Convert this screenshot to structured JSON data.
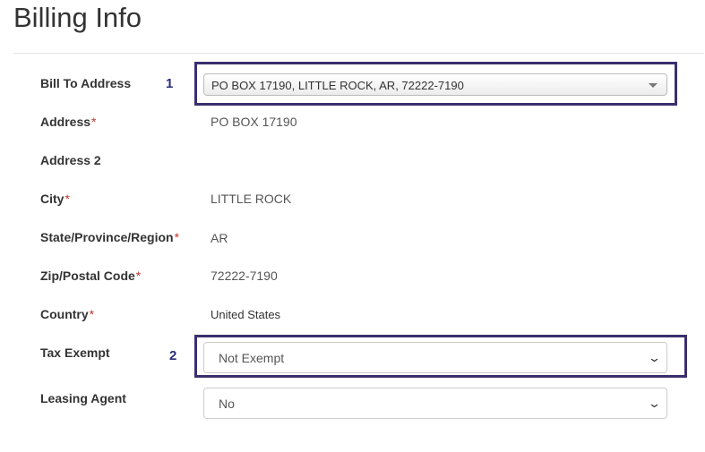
{
  "page_title": "Billing Info",
  "required_marker": "*",
  "fields": {
    "bill_to": {
      "label": "Bill To Address",
      "badge": "1",
      "selected": "PO BOX 17190, LITTLE ROCK, AR, 72222-7190"
    },
    "address": {
      "label": "Address",
      "value": "PO BOX 17190"
    },
    "address2": {
      "label": "Address 2",
      "value": ""
    },
    "city": {
      "label": "City",
      "value": "LITTLE ROCK"
    },
    "state": {
      "label": "State/Province/Region",
      "value": "AR"
    },
    "zip": {
      "label": "Zip/Postal Code",
      "value": "72222-7190"
    },
    "country": {
      "label": "Country",
      "value": "United States"
    },
    "tax_exempt": {
      "label": "Tax Exempt",
      "badge": "2",
      "selected": "Not Exempt"
    },
    "leasing_agent": {
      "label": "Leasing Agent",
      "selected": "No"
    }
  },
  "colors": {
    "highlight_border": "#3b2e6e",
    "badge_text": "#2b2f7a",
    "required": "#c0392b"
  },
  "icons": {
    "dropdown_caret": "caret-down-icon",
    "dropdown_chevron": "chevron-down-icon"
  }
}
